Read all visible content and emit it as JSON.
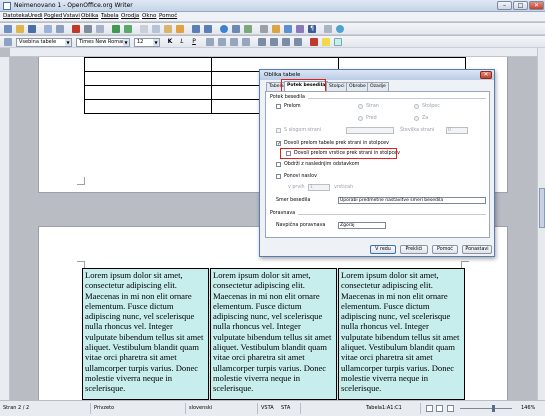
{
  "window": {
    "title": "Neimenovano 1 - OpenOffice.org Writer",
    "minimize_label": "–",
    "maximize_label": "□",
    "close_label": "✕"
  },
  "menu": [
    "Datoteka",
    "Uredi",
    "Pogled",
    "Vstavi",
    "Oblika",
    "Tabela",
    "Orodja",
    "Okno",
    "Pomoč"
  ],
  "format_toolbar": {
    "style_value": "Vsebina tabele",
    "font_value": "Times New Roman",
    "size_value": "12",
    "bold": "K",
    "italic": "L",
    "underline": "P"
  },
  "document": {
    "lorem": "Lorem ipsum dolor sit amet, consectetur adipiscing elit. Maecenas in mi non elit ornare elementum. Fusce dictum adipiscing nunc, vel scelerisque nulla rhoncus vel. Integer vulputate bibendum tellus sit amet aliquet. Vestibulum blandit quam vitae orci pharetra sit amet ullamcorper turpis varius. Donec molestie viverra neque in scelerisque."
  },
  "dialog": {
    "title": "Oblika tabele",
    "close_label": "✕",
    "tabs": [
      "Tabela",
      "Potek besedila",
      "Stolpci",
      "Obrobe",
      "Ozadje"
    ],
    "section_flow": "Potek besedila",
    "prelom": "Prelom",
    "stran": "Stran",
    "stolpec": "Stolpec",
    "pred": "Pred",
    "za": "Za",
    "s_slogom_strani": "S slogom strani",
    "stevilka_strani": "Številka strani",
    "stevilka_value": "0",
    "allow_split": "Dovoli prelom tabele prek strani in stolpcev",
    "allow_row_break": "Dovoli prelom vrstice prek strani in stolpcev",
    "obdrzi": "Obdrži z naslednjim odstavkom",
    "ponovi": "Ponovi naslov",
    "v_prvih": "v prvih",
    "v_prvih_value": "1",
    "vrsticah": "vrsticah",
    "smer_label": "Smer besedila",
    "smer_value": "Uporabi predmetne nastavitve smeri besedila",
    "section_align": "Poravnava",
    "navpicna_label": "Navpična poravnava",
    "navpicna_value": "Zgoraj",
    "buttons": [
      "V redu",
      "Prekliči",
      "Pomoč",
      "Ponastavi"
    ]
  },
  "statusbar": {
    "page": "Stran 2 / 2",
    "style": "Privzeto",
    "language": "slovenski",
    "mode": "VSTA",
    "sel": "STA",
    "cell": "Tabela1:A1:C1",
    "zoom": "146%"
  },
  "colors": {
    "table_fill": "#c7eded",
    "highlight_border": "#e0201b"
  }
}
